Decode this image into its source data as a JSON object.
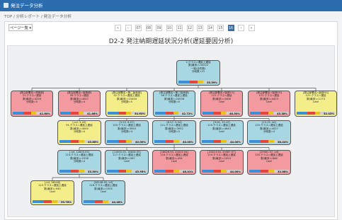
{
  "app": {
    "title": "発注データ分析"
  },
  "breadcrumb": {
    "text": "TOP / 分析レポート / 発注データ分析"
  },
  "toolbar": {
    "page_select": "ページ一覧 ▾"
  },
  "pager": {
    "labels": [
      "«",
      "‹",
      "07",
      "08",
      "09",
      "10",
      "11",
      "12",
      "13",
      "14",
      "15",
      "16",
      "›",
      "»"
    ],
    "active": "16"
  },
  "page_title": "D2-2 発注納期遅延状況分析(遅延要因分析)",
  "colors": {
    "blue": "#a7d7e2",
    "red": "#f29a9f",
    "yellow": "#f3ee8a",
    "accent": "#2c6db0"
  },
  "tree": {
    "root": {
      "l1": "2.クラス=遅延上遅延",
      "l2": "数(最多)=34222",
      "l3": "一致(全件数)",
      "l4": "分岐数=21",
      "pct": "35.59%"
    },
    "level1": [
      {
        "l1": "[発注部署名=資産部]",
        "l2": "21.クラス=遅延",
        "l3": "数(最多)=4226",
        "l4": "分岐数=5",
        "pct": "41.60%"
      },
      {
        "l1": "[発注部署名=製造部]",
        "l2": "30.クラス=遅延",
        "l3": "数(最多)=4047",
        "l4": "分岐数=4",
        "pct": "41.66%"
      },
      {
        "l1": "[発注部署名=第二製造部]",
        "l2": "32.クラス=遅延上遅延",
        "l3": "数(最多)=10404",
        "l4": "分岐数=5",
        "pct": "34.63%"
      },
      {
        "l1": "[発注部署名=第三製造部]",
        "l2": "36.クラス=遅延上遅延",
        "l3": "数(最多)=24558",
        "l4": "分岐数=5",
        "pct": "42.72%"
      },
      {
        "l1": "[発注部署名=製造1G]",
        "l2": "121.クラス=遅延",
        "l3": "数(最多)=4406",
        "l4": "Leaf",
        "pct": "46.50%"
      },
      {
        "l1": "[発注部署名=製造2G]",
        "l2": "121.クラス=遅延",
        "l3": "数(最多)=4423",
        "l4": "Leaf",
        "pct": "45.38%"
      },
      {
        "l1": "[発注部署名=製造3G]",
        "l2": "121.クラス=遅延",
        "l3": "数(最多)=1173",
        "l4": "Leaf",
        "pct": "52.43%"
      }
    ],
    "level2": [
      {
        "l1": "[-inf, 3.20]",
        "l2": "91.クラス=遅延上遅延",
        "l3": "数(最多)=4040",
        "l4": "分岐数=4",
        "pct": "40.88%"
      },
      {
        "l1": "[3.20, 6.57]",
        "l2": "105.クラス=遅延上遅延",
        "l3": "数(最多)=3950",
        "l4": "分岐数=4",
        "pct": "40.00%"
      },
      {
        "l1": "[6.57, 9.04]",
        "l2": "111.クラス=遅延上遅延",
        "l3": "数(最多)=3952",
        "l4": "分岐数=5",
        "pct": "40.00%"
      },
      {
        "l1": "[9.04, 13.15]",
        "l2": "115.クラス=遅延上遅延",
        "l3": "数(最多)=4643",
        "l4": "Leaf",
        "pct": "44.00%"
      },
      {
        "l1": "[13.15, inf]",
        "l2": "125.クラス=遅延上遅延",
        "l3": "数(最多)=4027",
        "l4": "分岐数=4",
        "pct": "38.44%"
      }
    ],
    "level3": [
      {
        "l1": "[-inf, 12805.05]",
        "l2": "114.クラス=遅延上遅延",
        "l3": "数(最多)=2338",
        "l4": "分岐数=4",
        "pct": "33.50%"
      },
      {
        "l1": "[12805.05, 18626.93]",
        "l2": "117.クラス=遅延上遅延",
        "l3": "数(最多)=567",
        "l4": "Leaf",
        "pct": "45.95%"
      },
      {
        "l1": "[18626.93, 22613.94]",
        "l2": "118.クラス=遅延上遅延",
        "l3": "数(最多)=494",
        "l4": "Leaf",
        "pct": "48.01%"
      },
      {
        "l1": "[22613.94, 29087.97]",
        "l2": "119.クラス=遅延上遅延",
        "l3": "数(最多)=1053",
        "l4": "Leaf",
        "pct": "44.00%"
      },
      {
        "l1": "[29087.97, inf]",
        "l2": "120.クラス=遅延上遅延",
        "l3": "数(最多)=846",
        "l4": "Leaf",
        "pct": "32.86%"
      }
    ],
    "level4": [
      {
        "l1": "[-inf, 58148]",
        "l2": "115.クラス=遅延上遅延",
        "l3": "数(最多)=940",
        "l4": "Leaf",
        "pct": "39.76%"
      },
      {
        "l1": "[58148.05, inf]",
        "l2": "116.クラス=遅延上遅延",
        "l3": "数(最多)=1555",
        "l4": "Leaf",
        "pct": "44.48%"
      }
    ]
  }
}
